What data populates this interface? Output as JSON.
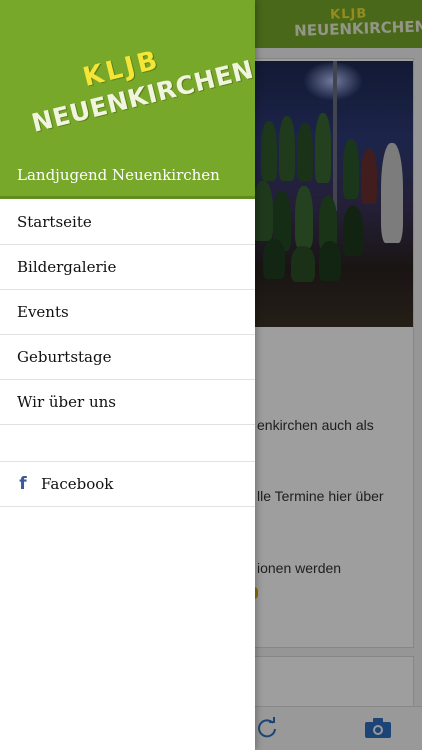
{
  "colors": {
    "brand_green": "#77a82a",
    "logo_yellow": "#f4e537",
    "facebook_blue": "#3b5998",
    "link_blue": "#2e6fc0"
  },
  "app_logo": {
    "line1": "KLJB",
    "line2": "NEUENKIRCHEN"
  },
  "drawer": {
    "logo": {
      "line1": "KLJB",
      "line2": "NEUENKIRCHEN"
    },
    "title": "Landjugend Neuenkirchen",
    "menu": [
      {
        "label": "Startseite"
      },
      {
        "label": "Bildergalerie"
      },
      {
        "label": "Events"
      },
      {
        "label": "Geburtstage"
      },
      {
        "label": "Wir über uns"
      }
    ],
    "social": {
      "icon": "facebook-icon",
      "glyph": "f",
      "label": "Facebook"
    }
  },
  "background": {
    "text_lines": [
      "enkirchen auch als",
      "lle Termine hier über",
      "ionen werden"
    ],
    "footer_icons": [
      "refresh-icon",
      "camera-icon"
    ]
  }
}
